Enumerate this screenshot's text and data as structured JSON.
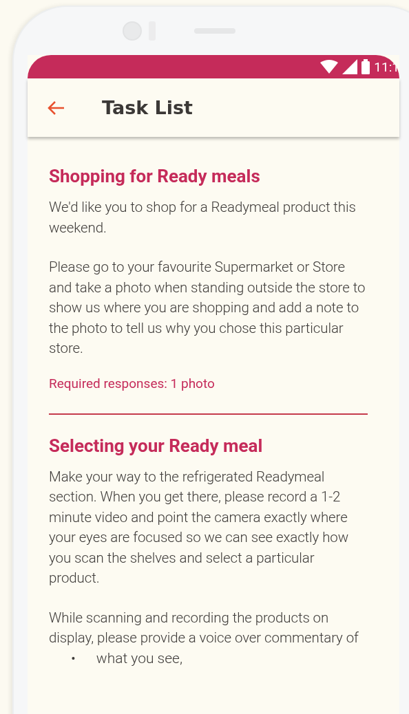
{
  "status_bar": {
    "time": "11:1"
  },
  "app_bar": {
    "title": "Task List"
  },
  "tasks": [
    {
      "title": "Shopping for Ready meals",
      "paragraphs": [
        "We'd like you to shop for a Readymeal product this weekend.",
        "Please go to your favourite Supermarket or Store and take a photo when standing outside the store to show us where you are shopping and add a note to the photo to tell us why you chose this particular store."
      ],
      "requirement": "Required responses: 1 photo"
    },
    {
      "title": "Selecting your Ready meal",
      "paragraphs": [
        "Make your way to the refrigerated Readymeal section. When you get there, please record a 1-2 minute video and point the camera exactly where your eyes are focused so we can see exactly how you scan the shelves and select a particular product.",
        "While scanning and recording the products on display, please provide a voice over commentary of"
      ],
      "bullets": [
        {
          "marker": "•",
          "text": "what you see,"
        }
      ]
    }
  ]
}
